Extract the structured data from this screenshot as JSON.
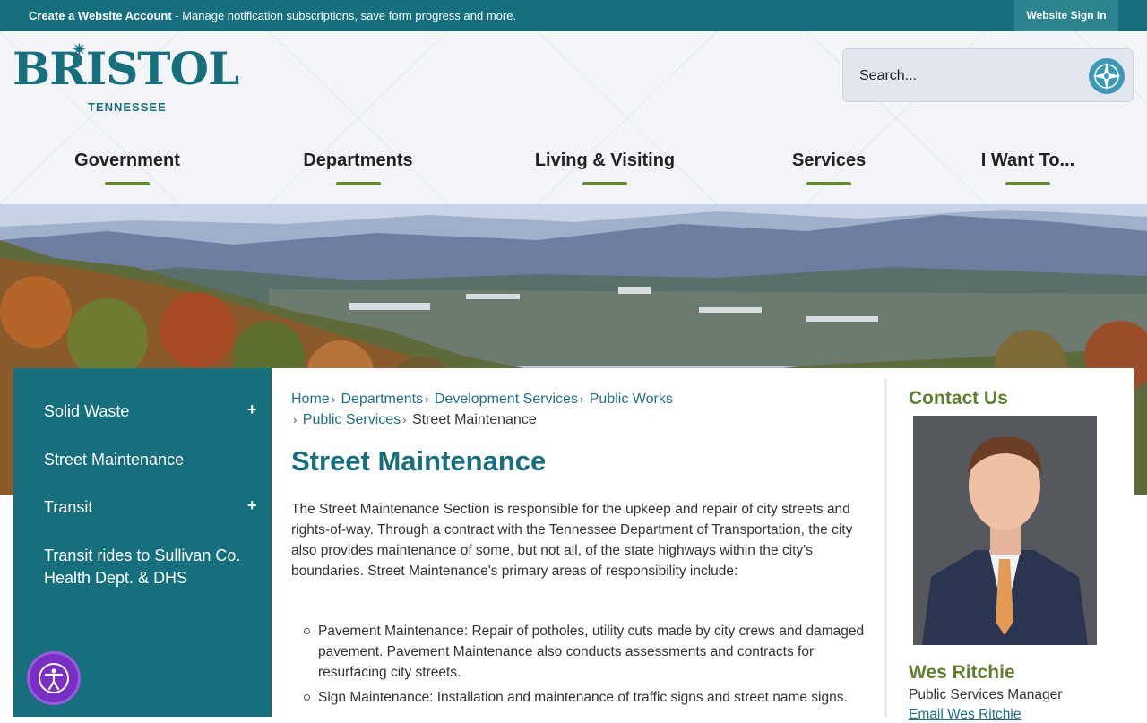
{
  "topbar": {
    "account_bold": "Create a Website Account",
    "account_rest": " - Manage notification subscriptions, save form progress and more.",
    "signin": "Website Sign In"
  },
  "logo": {
    "word": "BRISTOL",
    "state": "TENNESSEE"
  },
  "search": {
    "placeholder": "Search...",
    "icon": "compass-search-icon"
  },
  "nav": [
    "Government",
    "Departments",
    "Living & Visiting",
    "Services",
    "I Want To..."
  ],
  "sidebar": {
    "items": [
      {
        "label": "Solid Waste",
        "expandable": "+"
      },
      {
        "label": "Street Maintenance"
      },
      {
        "label": "Transit",
        "expandable": "+"
      },
      {
        "label": "Transit rides to Sullivan Co. Health Dept. & DHS"
      }
    ]
  },
  "breadcrumb": {
    "items": [
      "Home",
      "Departments",
      "Development Services",
      "Public Works",
      "Public Services"
    ],
    "current": "Street Maintenance",
    "separator": "›"
  },
  "page": {
    "title": "Street Maintenance",
    "intro": "The Street Maintenance Section is responsible for the upkeep and repair of city streets and rights-of-way. Through a contract with the Tennessee Department of Transportation, the city also provides maintenance of some, but not all, of the state highways within the city's boundaries. Street Maintenance's primary areas of responsibility include:",
    "list": [
      "Pavement Maintenance: Repair of potholes, utility cuts made by city crews and damaged pavement. Pavement Maintenance also conducts assessments and contracts for resurfacing city streets.",
      "Sign Maintenance: Installation and maintenance of traffic signs and street name signs."
    ]
  },
  "contact": {
    "heading": "Contact Us",
    "name": "Wes Ritchie",
    "role": "Public Services Manager",
    "email": "Email Wes Ritchie"
  },
  "colors": {
    "teal": "#156f7c",
    "green": "#5f8a2f",
    "link": "#1f6f86",
    "a11y": "#7a2fc4"
  }
}
